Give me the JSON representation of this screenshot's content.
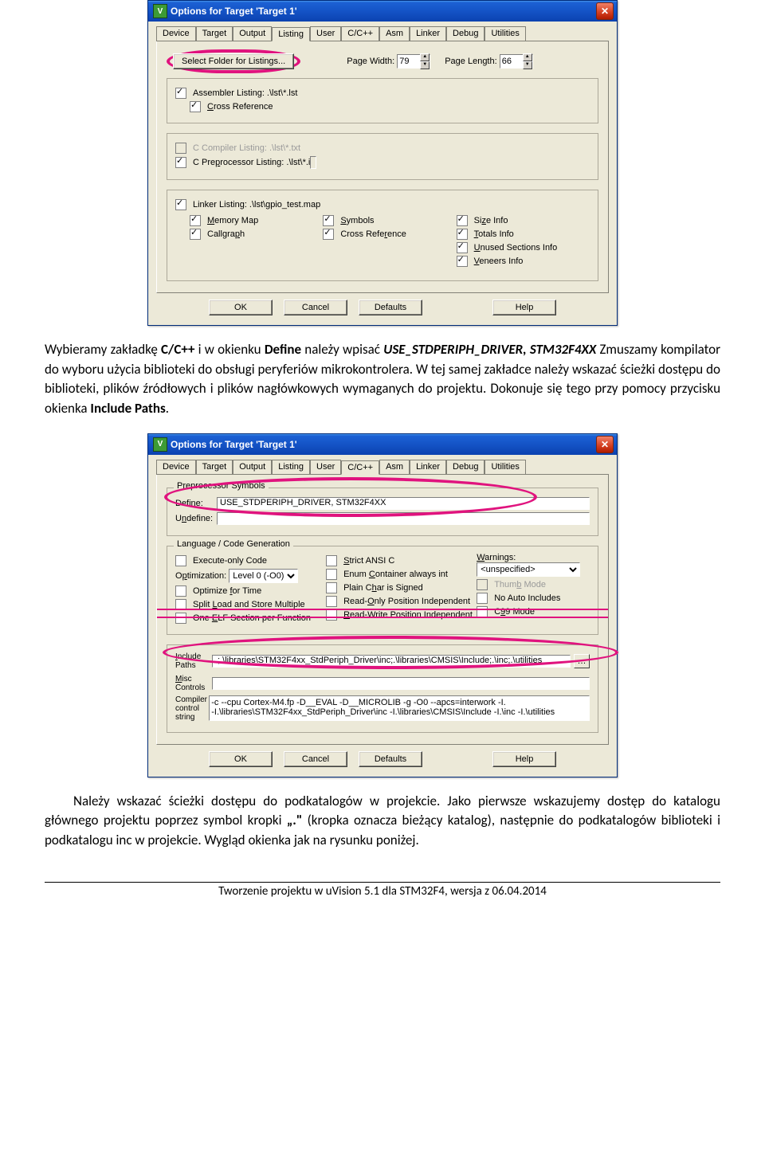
{
  "dialog1": {
    "title": "Options for Target 'Target 1'",
    "tabs": [
      "Device",
      "Target",
      "Output",
      "Listing",
      "User",
      "C/C++",
      "Asm",
      "Linker",
      "Debug",
      "Utilities"
    ],
    "activeTab": "Listing",
    "selectFolderBtn": "Select Folder for Listings...",
    "pageWidthLbl": "Page Width:",
    "pageWidthVal": "79",
    "pageLengthLbl": "Page Length:",
    "pageLengthVal": "66",
    "asmListing": "Assembler Listing: .\\lst\\*.lst",
    "crossRef1": "Cross Reference",
    "cCompilerListing": "C Compiler Listing: .\\lst\\*.txt",
    "cPreprocListing": "C Preprocessor Listing: .\\lst\\*.i",
    "linkerListing": "Linker Listing: .\\lst\\gpio_test.map",
    "memoryMap": "Memory Map",
    "callgraph": "Callgraph",
    "symbols": "Symbols",
    "crossRef2": "Cross Reference",
    "sizeInfo": "Size Info",
    "totalsInfo": "Totals Info",
    "unusedSections": "Unused Sections Info",
    "veneers": "Veneers Info",
    "btns": {
      "ok": "OK",
      "cancel": "Cancel",
      "defaults": "Defaults",
      "help": "Help"
    }
  },
  "para1_a": "Wybieramy zakładkę ",
  "para1_b": "C/C++",
  "para1_c": " i w okienku ",
  "para1_d": "Define",
  "para1_e": " należy wpisać ",
  "para1_f": "USE_STDPERIPH_DRIVER, STM32F4XX",
  "para1_g": " Zmuszamy kompilator do wyboru użycia biblioteki do obsługi peryferiów mikrokontrolera. W tej samej zakładce należy wskazać ścieżki dostępu do biblioteki, plików źródłowych i plików nagłówkowych wymaganych do projektu. Dokonuje się tego przy pomocy przycisku okienka ",
  "para1_h": "Include Paths",
  "para1_i": ".",
  "dialog2": {
    "title": "Options for Target 'Target 1'",
    "tabs": [
      "Device",
      "Target",
      "Output",
      "Listing",
      "User",
      "C/C++",
      "Asm",
      "Linker",
      "Debug",
      "Utilities"
    ],
    "activeTab": "C/C++",
    "preprocGroup": "Preprocessor Symbols",
    "defineLbl": "Define:",
    "defineVal": "USE_STDPERIPH_DRIVER, STM32F4XX",
    "undefineLbl": "Undefine:",
    "langGroup": "Language / Code Generation",
    "execOnly": "Execute-only Code",
    "optLbl": "Optimization:",
    "optVal": "Level 0 (-O0)",
    "optTime": "Optimize for Time",
    "splitLoad": "Split Load and Store Multiple",
    "oneElf": "One ELF Section per Function",
    "strictAnsi": "Strict ANSI C",
    "enumContainer": "Enum Container always int",
    "plainChar": "Plain Char is Signed",
    "roPos": "Read-Only Position Independent",
    "rwPos": "Read-Write Position Independent",
    "warningsLbl": "Warnings:",
    "warningsVal": "<unspecified>",
    "thumb": "Thumb Mode",
    "noAuto": "No Auto Includes",
    "c99": "C99 Mode",
    "includeLbl": "Include\nPaths",
    "includeVal": ".;.\\libraries\\STM32F4xx_StdPeriph_Driver\\inc;.\\libraries\\CMSIS\\Include;.\\inc;.\\utilities",
    "miscLbl": "Misc\nControls",
    "compilerLbl": "Compiler\ncontrol\nstring",
    "compilerVal": "-c --cpu Cortex-M4.fp -D__EVAL -D__MICROLIB -g -O0 --apcs=interwork -I.\n-I.\\libraries\\STM32F4xx_StdPeriph_Driver\\inc -I.\\libraries\\CMSIS\\Include -I.\\inc -I.\\utilities",
    "btns": {
      "ok": "OK",
      "cancel": "Cancel",
      "defaults": "Defaults",
      "help": "Help"
    }
  },
  "para2": "Należy wskazać ścieżki dostępu do podkatalogów w projekcie. Jako pierwsze wskazujemy dostęp do katalogu głównego projektu poprzez symbol kropki ",
  "para2_b": "„.\"",
  "para2_c": " (kropka oznacza bieżący katalog),  następnie do podkatalogów biblioteki i podkatalogu inc w projekcie. Wygląd okienka jak na rysunku poniżej.",
  "footer": "Tworzenie projektu w uVision 5.1 dla STM32F4,  wersja z 06.04.2014"
}
